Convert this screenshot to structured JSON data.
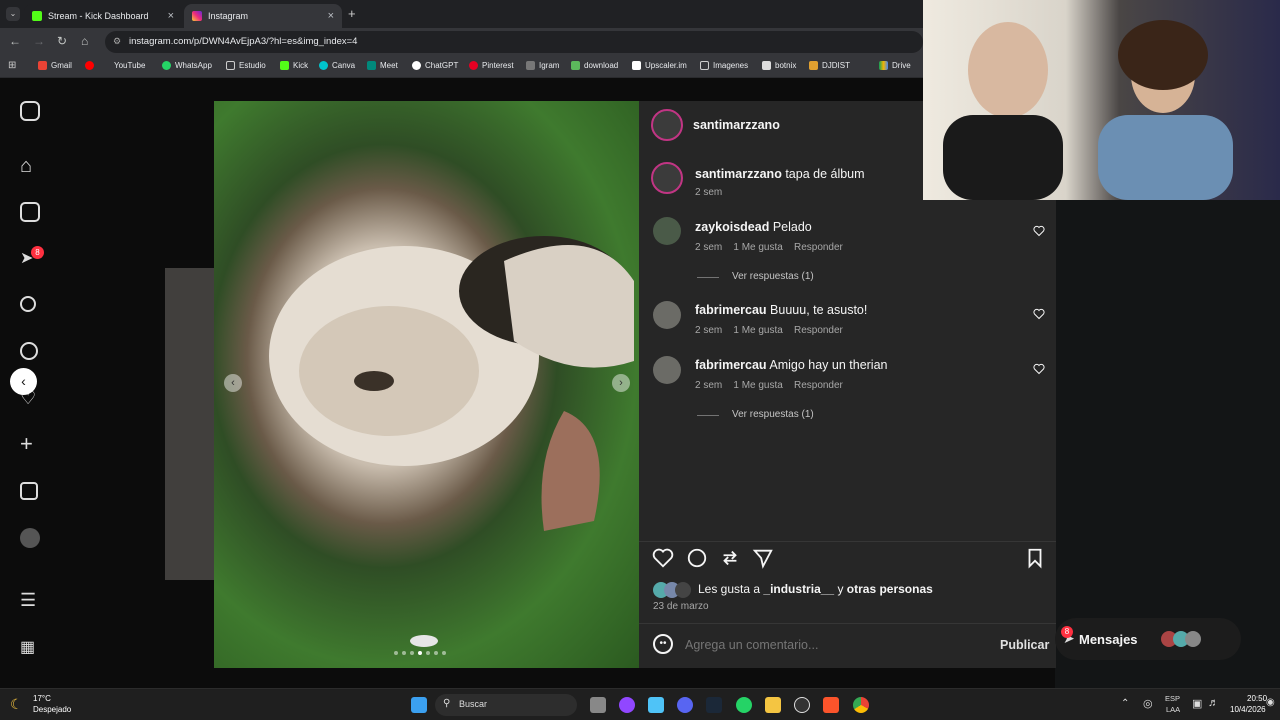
{
  "browser": {
    "tabs": [
      {
        "label": "Stream - Kick Dashboard",
        "active": false
      },
      {
        "label": "Instagram",
        "active": true
      }
    ],
    "url": "instagram.com/p/DWN4AvEjpA3/?hl=es&img_index=4",
    "bookmarks": [
      "Gmail",
      "YouTube",
      "WhatsApp",
      "Estudio",
      "Kick",
      "Canva",
      "Meet",
      "ChatGPT",
      "Pinterest",
      "Igram",
      "download",
      "Upscaler.im",
      "Imagenes",
      "botnix",
      "DJDIST",
      "Drive"
    ]
  },
  "sidebar": {
    "notification_badge": "8"
  },
  "post": {
    "author": "santimarzzano",
    "caption_author": "santimarzzano",
    "caption_text": "tapa de álbum",
    "caption_time": "2 sem",
    "comments": [
      {
        "user": "zaykoisdead",
        "text": "Pelado",
        "time": "2 sem",
        "likes": "1 Me gusta",
        "reply": "Responder",
        "view_replies": "Ver respuestas (1)"
      },
      {
        "user": "fabrimercau",
        "text": "Buuuu, te asusto!",
        "time": "2 sem",
        "likes": "1 Me gusta",
        "reply": "Responder",
        "view_replies": ""
      },
      {
        "user": "fabrimercau",
        "text": "Amigo hay un therian",
        "time": "2 sem",
        "likes": "1 Me gusta",
        "reply": "Responder",
        "view_replies": "Ver respuestas (1)"
      }
    ],
    "likes_prefix": "Les gusta a",
    "likes_user": "_industria__",
    "likes_conj": "y",
    "likes_others": "otras personas",
    "date": "23 de marzo",
    "comment_placeholder": "Agrega un comentario...",
    "publish_label": "Publicar"
  },
  "messages": {
    "label": "Mensajes",
    "badge": "8"
  },
  "taskbar": {
    "weather_temp": "17°C",
    "weather_desc": "Despejado",
    "search_label": "Buscar",
    "lang_top": "ESP",
    "lang_bottom": "LAA",
    "time": "20:50",
    "date": "10/4/2026"
  },
  "colors": {
    "panel_bg": "#262626",
    "publish": "#e0e0e0",
    "story_ring": "#c13584"
  }
}
